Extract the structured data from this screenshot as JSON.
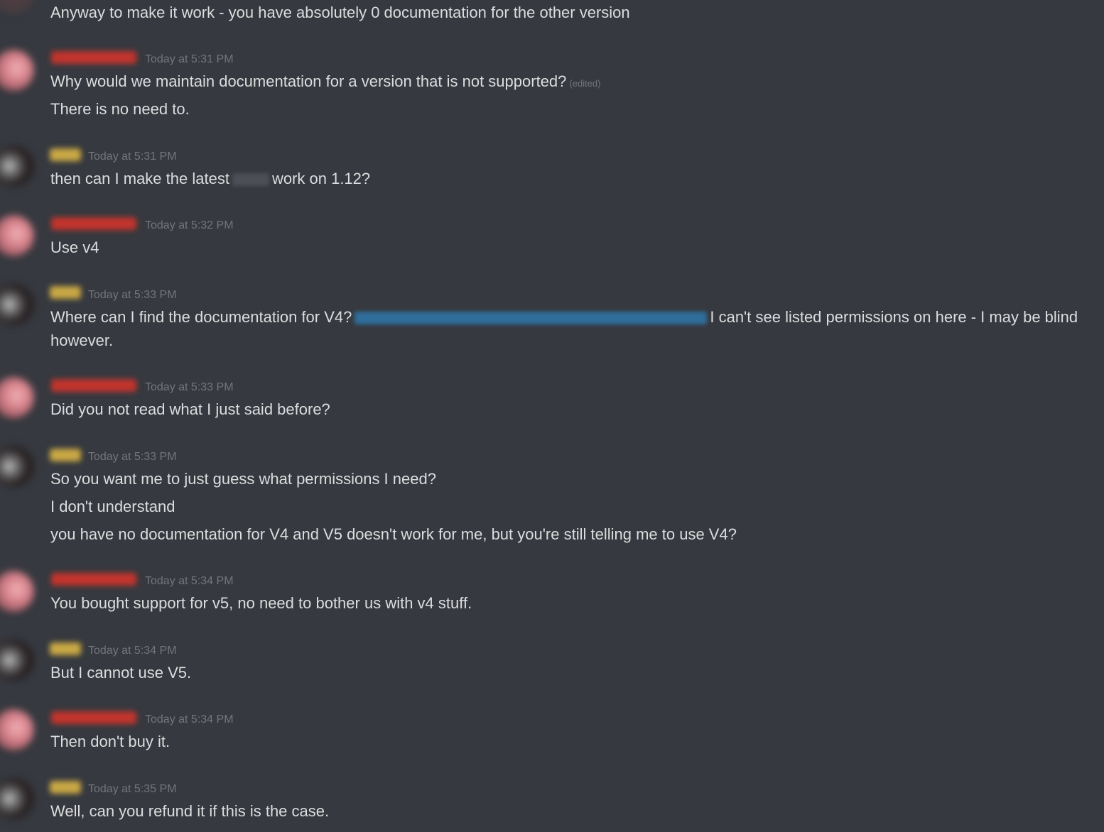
{
  "colors": {
    "background": "#36393f",
    "text": "#dcddde",
    "timestamp": "#72767d",
    "user_a_name": "#c3342d",
    "user_b_name": "#c9a845",
    "link": "#2f6e9a"
  },
  "messages": [
    {
      "lines": [
        "Anyway to make it work - you have absolutely 0 documentation for the other version"
      ]
    },
    {
      "timestamp": "Today at 5:31 PM",
      "line1": "Why would we maintain documentation for a version that is not supported?",
      "edited": "(edited)",
      "line2": "There is no need to."
    },
    {
      "timestamp": "Today at 5:31 PM",
      "before_blur": "then can I make the latest",
      "after_blur": "work on 1.12?"
    },
    {
      "timestamp": "Today at 5:32 PM",
      "lines": [
        "Use v4"
      ]
    },
    {
      "timestamp": "Today at 5:33 PM",
      "before_link": "Where can I find the documentation for V4?",
      "after_link": "I can't see listed permissions on here - I may be blind",
      "line2": "however."
    },
    {
      "timestamp": "Today at 5:33 PM",
      "lines": [
        "Did you not read what I just said before?"
      ]
    },
    {
      "timestamp": "Today at 5:33 PM",
      "lines": [
        "So you want me to just guess what permissions I need?",
        "I don't understand",
        "you have no documentation for V4 and V5 doesn't work for me, but you're still telling me to use V4?"
      ]
    },
    {
      "timestamp": "Today at 5:34 PM",
      "lines": [
        "You bought support for v5, no need to bother us with v4 stuff."
      ]
    },
    {
      "timestamp": "Today at 5:34 PM",
      "lines": [
        "But I cannot use V5."
      ]
    },
    {
      "timestamp": "Today at 5:34 PM",
      "lines": [
        "Then don't buy it."
      ]
    },
    {
      "timestamp": "Today at 5:35 PM",
      "lines": [
        "Well, can you refund it if this is the case."
      ]
    }
  ]
}
